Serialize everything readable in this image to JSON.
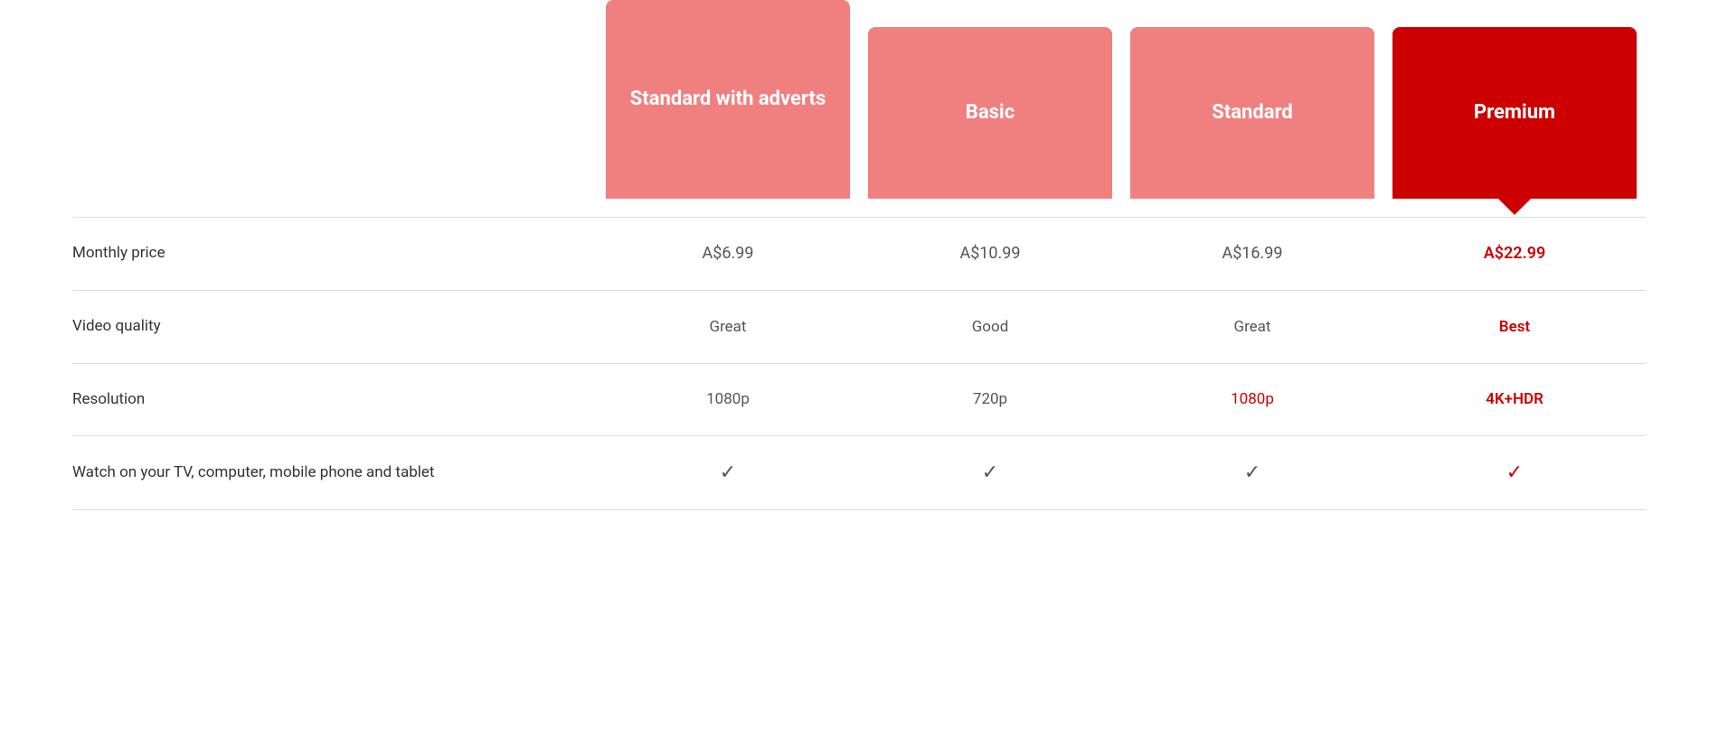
{
  "plans": [
    {
      "id": "standard-adverts",
      "label": "Standard with adverts",
      "colorClass": "standard-adverts",
      "accentColor": "#f08080"
    },
    {
      "id": "basic",
      "label": "Basic",
      "colorClass": "basic",
      "accentColor": "#f08080"
    },
    {
      "id": "standard",
      "label": "Standard",
      "colorClass": "standard",
      "accentColor": "#f08080"
    },
    {
      "id": "premium",
      "label": "Premium",
      "colorClass": "premium",
      "accentColor": "#cc0000"
    }
  ],
  "rows": [
    {
      "id": "monthly-price",
      "label": "Monthly price",
      "values": [
        "A$6.99",
        "A$10.99",
        "A$16.99",
        "A$22.99"
      ],
      "premiumIndex": 3,
      "type": "price"
    },
    {
      "id": "video-quality",
      "label": "Video quality",
      "values": [
        "Great",
        "Good",
        "Great",
        "Best"
      ],
      "premiumIndex": 3,
      "type": "text"
    },
    {
      "id": "resolution",
      "label": "Resolution",
      "values": [
        "1080p",
        "720p",
        "1080p",
        "4K+HDR"
      ],
      "premiumIndex": 3,
      "standardHighlight": [
        0,
        2
      ],
      "type": "text"
    },
    {
      "id": "watch-devices",
      "label": "Watch on your TV, computer, mobile phone and tablet",
      "values": [
        "✓",
        "✓",
        "✓",
        "✓"
      ],
      "premiumIndex": 3,
      "type": "check"
    }
  ]
}
